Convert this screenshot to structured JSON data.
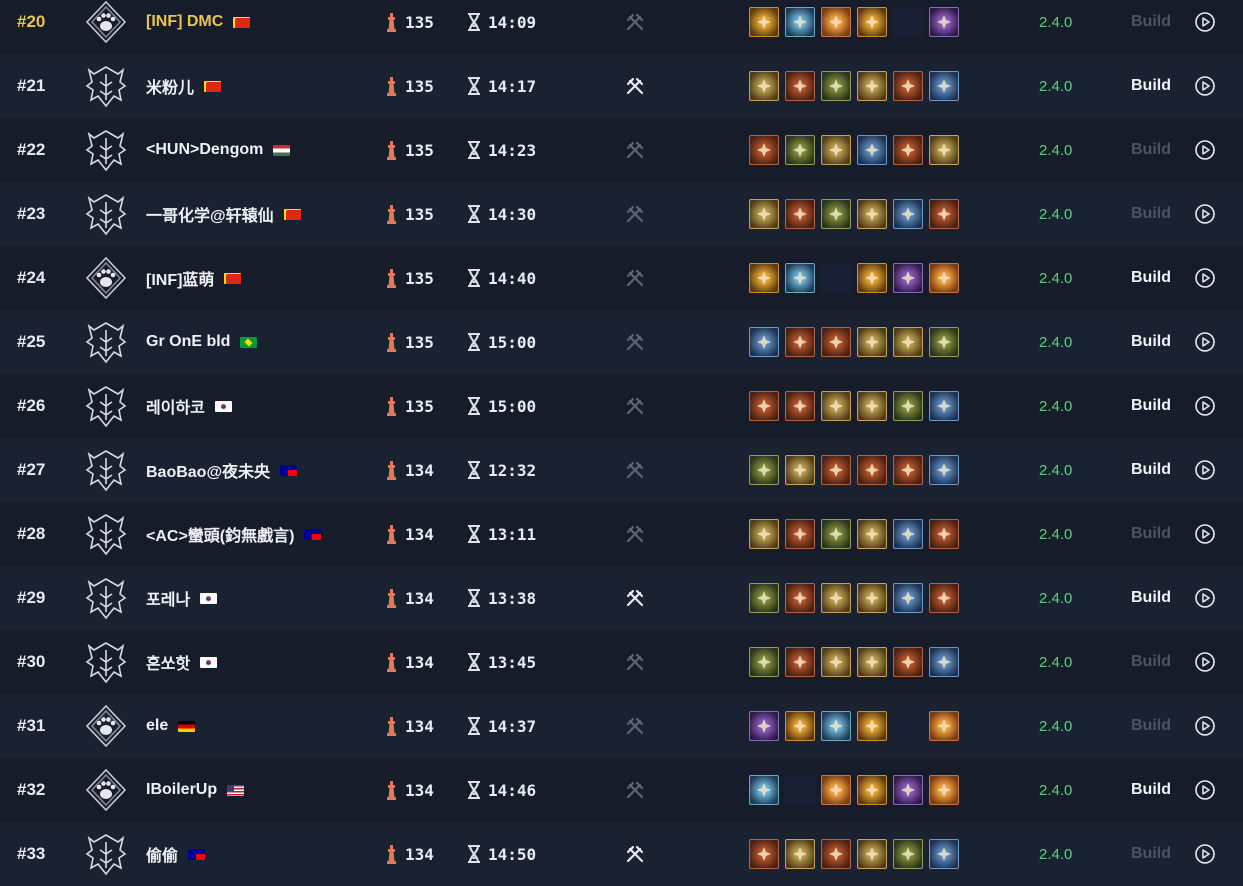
{
  "colors": {
    "background": "#151b28",
    "highlight_rank": "#e9c64b",
    "version": "#59d180",
    "build_active": "#f0f2f6",
    "build_disabled": "#4b5366"
  },
  "build_label": "Build",
  "rows": [
    {
      "rank": "#20",
      "player": "[INF] DMC",
      "flag": "cn",
      "crest": "paw-crest-icon",
      "tier": "135",
      "time": "14:09",
      "hardcore": false,
      "skills": [
        "amber",
        "cyan",
        "orange",
        "amber",
        "empty",
        "purple"
      ],
      "version": "2.4.0",
      "build_enabled": false,
      "highlight": true
    },
    {
      "rank": "#21",
      "player": "米粉儿",
      "flag": "cn",
      "crest": "demon-crest-icon",
      "tier": "135",
      "time": "14:17",
      "hardcore": true,
      "skills": [
        "gold",
        "red",
        "green",
        "gold",
        "red",
        "blue"
      ],
      "version": "2.4.0",
      "build_enabled": true
    },
    {
      "rank": "#22",
      "player": "<HUN>Dengom",
      "flag": "hu",
      "crest": "demon-crest-icon",
      "tier": "135",
      "time": "14:23",
      "hardcore": false,
      "skills": [
        "red",
        "green",
        "gold",
        "blue",
        "red",
        "gold"
      ],
      "version": "2.4.0",
      "build_enabled": false
    },
    {
      "rank": "#23",
      "player": "一哥化学@轩辕仙",
      "flag": "cn",
      "crest": "demon-crest-icon",
      "tier": "135",
      "time": "14:30",
      "hardcore": false,
      "skills": [
        "gold",
        "red",
        "green",
        "gold",
        "blue",
        "red"
      ],
      "version": "2.4.0",
      "build_enabled": false
    },
    {
      "rank": "#24",
      "player": "[INF]蓝萌",
      "flag": "cn",
      "crest": "paw-crest-icon",
      "tier": "135",
      "time": "14:40",
      "hardcore": false,
      "skills": [
        "amber",
        "cyan",
        "empty",
        "amber",
        "purple",
        "orange"
      ],
      "version": "2.4.0",
      "build_enabled": true
    },
    {
      "rank": "#25",
      "player": "Gr OnE bld",
      "flag": "br",
      "crest": "demon-crest-icon",
      "tier": "135",
      "time": "15:00",
      "hardcore": false,
      "skills": [
        "blue",
        "red",
        "red",
        "gold",
        "gold",
        "green"
      ],
      "version": "2.4.0",
      "build_enabled": true
    },
    {
      "rank": "#26",
      "player": "레이하코",
      "flag": "kr",
      "crest": "demon-crest-icon",
      "tier": "135",
      "time": "15:00",
      "hardcore": false,
      "skills": [
        "red",
        "red",
        "gold",
        "gold",
        "green",
        "blue"
      ],
      "version": "2.4.0",
      "build_enabled": true
    },
    {
      "rank": "#27",
      "player": "BaoBao@夜未央",
      "flag": "tw",
      "crest": "demon-crest-icon",
      "tier": "134",
      "time": "12:32",
      "hardcore": false,
      "skills": [
        "green",
        "gold",
        "red",
        "red",
        "red",
        "blue"
      ],
      "version": "2.4.0",
      "build_enabled": true
    },
    {
      "rank": "#28",
      "player": "<AC>蠻頭(鈞無戲言)",
      "flag": "tw",
      "crest": "demon-crest-icon",
      "tier": "134",
      "time": "13:11",
      "hardcore": false,
      "skills": [
        "gold",
        "red",
        "green",
        "gold",
        "blue",
        "red"
      ],
      "version": "2.4.0",
      "build_enabled": false
    },
    {
      "rank": "#29",
      "player": "포레나",
      "flag": "kr",
      "crest": "demon-crest-icon",
      "tier": "134",
      "time": "13:38",
      "hardcore": true,
      "skills": [
        "green",
        "red",
        "gold",
        "gold",
        "blue",
        "red"
      ],
      "version": "2.4.0",
      "build_enabled": true
    },
    {
      "rank": "#30",
      "player": "혼쏘핫",
      "flag": "kr",
      "crest": "demon-crest-icon",
      "tier": "134",
      "time": "13:45",
      "hardcore": false,
      "skills": [
        "green",
        "red",
        "gold",
        "gold",
        "red",
        "blue"
      ],
      "version": "2.4.0",
      "build_enabled": false
    },
    {
      "rank": "#31",
      "player": "ele",
      "flag": "de",
      "crest": "paw-crest-icon",
      "tier": "134",
      "time": "14:37",
      "hardcore": false,
      "skills": [
        "purple",
        "amber",
        "cyan",
        "amber",
        "empty",
        "orange"
      ],
      "version": "2.4.0",
      "build_enabled": false
    },
    {
      "rank": "#32",
      "player": "IBoilerUp",
      "flag": "us",
      "crest": "paw-crest-icon",
      "tier": "134",
      "time": "14:46",
      "hardcore": false,
      "skills": [
        "cyan",
        "empty",
        "orange",
        "amber",
        "purple",
        "orange"
      ],
      "version": "2.4.0",
      "build_enabled": true
    },
    {
      "rank": "#33",
      "player": "偷偷",
      "flag": "tw",
      "crest": "demon-crest-icon",
      "tier": "134",
      "time": "14:50",
      "hardcore": true,
      "skills": [
        "red",
        "gold",
        "red",
        "gold",
        "green",
        "blue"
      ],
      "version": "2.4.0",
      "build_enabled": false
    }
  ]
}
